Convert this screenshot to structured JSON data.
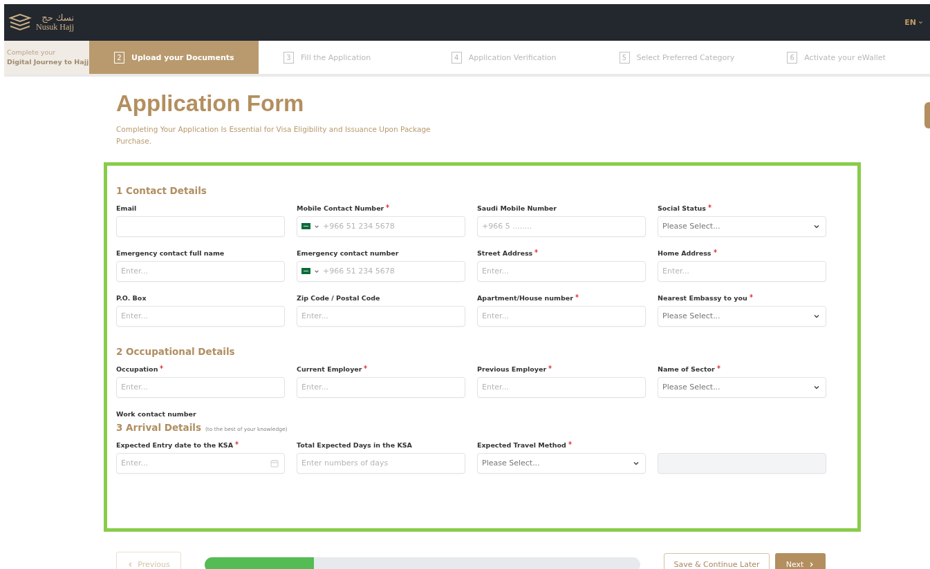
{
  "header": {
    "logo_arabic": "نسك حج",
    "logo_text": "Nusuk Hajj",
    "language": "EN"
  },
  "stepper": {
    "intro": [
      "Complete your",
      "Digital Journey to Hajj"
    ],
    "steps": [
      {
        "number": "2",
        "label": "Upload your Documents",
        "selected": true
      },
      {
        "number": "3",
        "label": "Fill the Application",
        "selected": false
      },
      {
        "number": "4",
        "label": "Application Verification",
        "selected": false
      },
      {
        "number": "5",
        "label": "Select Preferred Category",
        "selected": false
      },
      {
        "number": "6",
        "label": "Activate your eWallet",
        "selected": false
      }
    ]
  },
  "title": "Application Form",
  "subtitle": "Completing Your Application Is Essential for Visa Eligibility and Issuance Upon Package Purchase.",
  "sections": [
    {
      "heading": "1 Contact Details",
      "rows": [
        [
          {
            "label": "Email",
            "required": false,
            "kind": "text"
          },
          {
            "label": "Mobile Contact Number",
            "required": true,
            "kind": "phone",
            "placeholder": "+966 51 234 5678"
          },
          {
            "label": "Saudi Mobile Number",
            "required": false,
            "kind": "text",
            "placeholder": "+966 5 ........"
          },
          {
            "label": "Social Status",
            "required": true,
            "kind": "select",
            "placeholder": "Please Select..."
          }
        ],
        [
          {
            "label": "Emergency contact full name",
            "required": false,
            "kind": "text",
            "placeholder": "Enter..."
          },
          {
            "label": "Emergency contact number",
            "required": false,
            "kind": "phone",
            "placeholder": "+966 51 234 5678"
          },
          {
            "label": "Street Address",
            "required": true,
            "kind": "text",
            "placeholder": "Enter..."
          },
          {
            "label": "Home Address",
            "required": true,
            "kind": "text",
            "placeholder": "Enter..."
          }
        ],
        [
          {
            "label": "P.O. Box",
            "required": false,
            "kind": "text",
            "placeholder": "Enter..."
          },
          {
            "label": "Zip Code / Postal Code",
            "required": false,
            "kind": "text",
            "placeholder": "Enter..."
          },
          {
            "label": "Apartment/House number",
            "required": true,
            "kind": "text",
            "placeholder": "Enter..."
          },
          {
            "label": "Nearest Embassy to you",
            "required": true,
            "kind": "select",
            "placeholder": "Please Select..."
          }
        ]
      ]
    },
    {
      "heading": "2 Occupational Details",
      "rows": [
        [
          {
            "label": "Occupation",
            "required": true,
            "kind": "text",
            "placeholder": "Enter..."
          },
          {
            "label": "Current Employer",
            "required": true,
            "kind": "text",
            "placeholder": "Enter..."
          },
          {
            "label": "Previous Employer",
            "required": true,
            "kind": "text",
            "placeholder": "Enter..."
          },
          {
            "label": "Name of Sector",
            "required": true,
            "kind": "select",
            "placeholder": "Please Select..."
          }
        ],
        [
          {
            "label": "Work contact number",
            "required": false,
            "kind": "label"
          }
        ]
      ]
    },
    {
      "heading": "3 Arrival Details",
      "note": "(to the best of your knowledge)",
      "rows": [
        [
          {
            "label": "Expected Entry date to the KSA",
            "required": true,
            "kind": "date",
            "placeholder": "Enter..."
          },
          {
            "label": "Total Expected Days in the KSA",
            "required": false,
            "kind": "text",
            "placeholder": "Enter numbers of days"
          },
          {
            "label": "Expected Travel Method",
            "required": true,
            "kind": "select",
            "placeholder": "Please Select..."
          },
          {
            "kind": "disabled"
          }
        ]
      ]
    }
  ],
  "footer": {
    "previous": "Previous",
    "progress": {
      "level": 0.25
    },
    "save": "Save & Continue Later",
    "next": "Next"
  }
}
